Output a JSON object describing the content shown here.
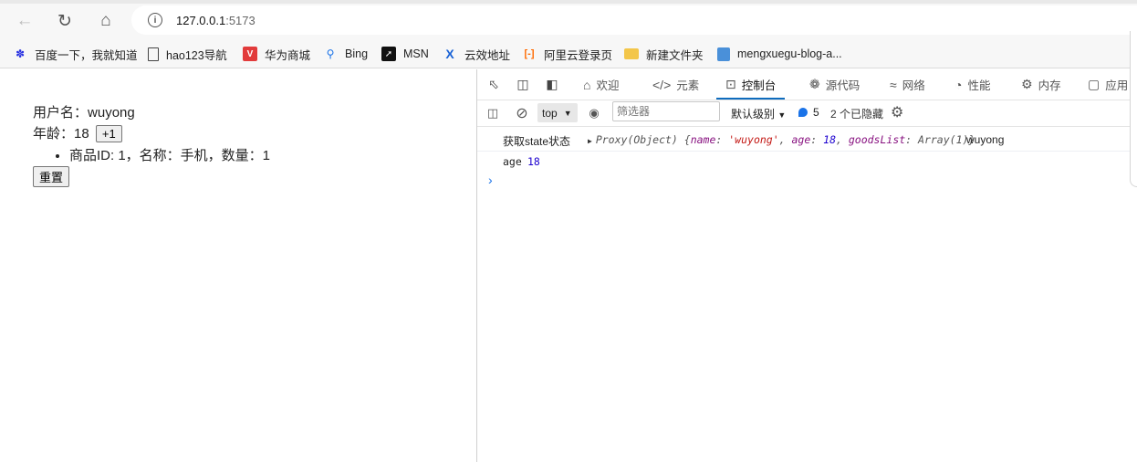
{
  "browser": {
    "url_host": "127.0.0.1",
    "url_port": ":5173",
    "bookmarks": [
      {
        "label": "百度一下，我就知道",
        "icon": "paw-icon"
      },
      {
        "label": "hao123导航",
        "icon": "page-icon"
      },
      {
        "label": "华为商城",
        "icon": "vmall-icon"
      },
      {
        "label": "Bing",
        "icon": "search-icon"
      },
      {
        "label": "MSN",
        "icon": "msn-icon"
      },
      {
        "label": "云效地址",
        "icon": "x-icon"
      },
      {
        "label": "阿里云登录页",
        "icon": "aliyun-icon"
      },
      {
        "label": "新建文件夹",
        "icon": "folder-icon"
      },
      {
        "label": "mengxuegu-blog-a...",
        "icon": "file-icon"
      }
    ]
  },
  "app": {
    "username_label": "用户名：",
    "username": "wuyong",
    "age_label": "年龄：",
    "age": "18",
    "inc_button": "+1",
    "goods_item": "商品ID: 1，名称：手机，数量：1",
    "reset_button": "重置"
  },
  "devtools": {
    "tabs": [
      {
        "label": "欢迎",
        "icon": "home-icon"
      },
      {
        "label": "元素",
        "icon": "code-icon"
      },
      {
        "label": "控制台",
        "icon": "console-icon",
        "active": true
      },
      {
        "label": "源代码",
        "icon": "bug-icon"
      },
      {
        "label": "网络",
        "icon": "wifi-icon"
      },
      {
        "label": "性能",
        "icon": "gauge-icon"
      },
      {
        "label": "内存",
        "icon": "chip-icon"
      },
      {
        "label": "应用",
        "icon": "app-icon"
      }
    ],
    "context": "top",
    "filter_placeholder": "筛选器",
    "levels": "默认级别",
    "message_count": "5",
    "hidden_count": "2 个已隐藏",
    "log": [
      {
        "label": "获取state状态",
        "proxy_prefix": "Proxy(Object) {",
        "name_key": "name",
        "name_val": "'wuyong'",
        "age_key": "age",
        "age_val": "18",
        "goods_key": "goodsList",
        "goods_val": "Array(1)",
        "suffix": "}",
        "extra": "wuyong"
      },
      {
        "key": "age",
        "value": "18"
      }
    ]
  }
}
